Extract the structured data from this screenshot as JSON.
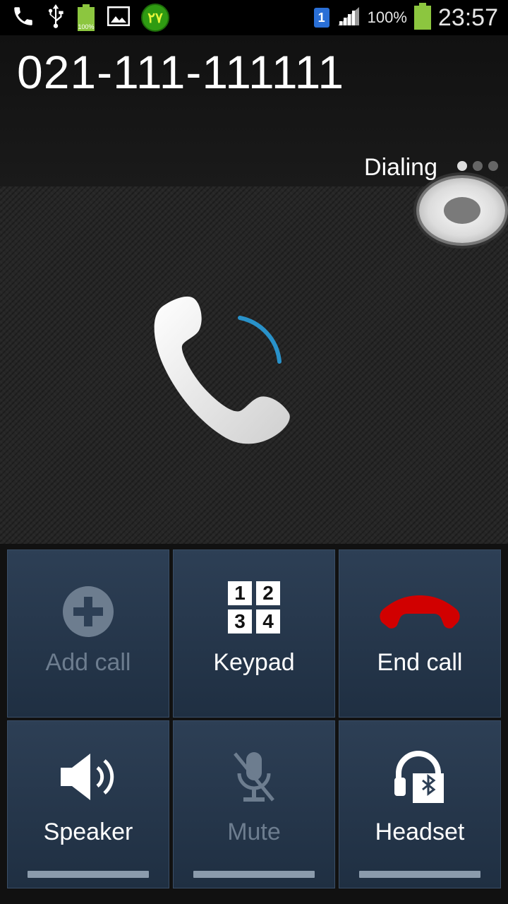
{
  "status_bar": {
    "badge_text": "۲۷",
    "sim_slot": "1",
    "battery_percent": "100%",
    "battery_icon_text": "100%",
    "time": "23:57"
  },
  "call": {
    "number": "021-111-111111",
    "state": "Dialing"
  },
  "buttons": {
    "add_call": "Add call",
    "keypad": "Keypad",
    "keypad_digits": [
      "1",
      "2",
      "3",
      "4"
    ],
    "end_call": "End call",
    "speaker": "Speaker",
    "mute": "Mute",
    "headset": "Headset"
  },
  "colors": {
    "button_bg": "#2d3f55",
    "end_call_red": "#d10000",
    "disabled_text": "#6d7d8f",
    "ring_accent": "#2aa6e8"
  }
}
